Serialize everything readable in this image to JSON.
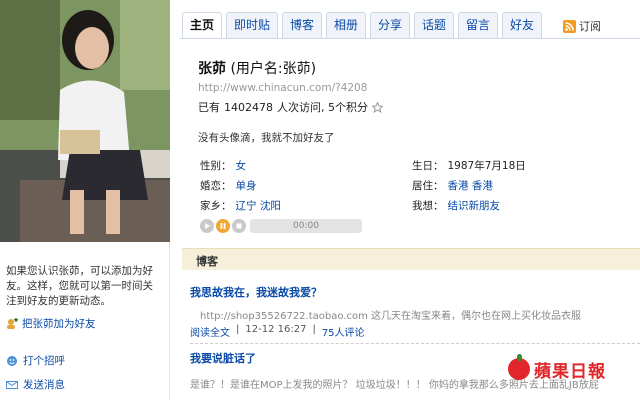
{
  "tabs": [
    "主页",
    "即时贴",
    "博客",
    "相册",
    "分享",
    "话题",
    "留言",
    "好友"
  ],
  "rss_label": "订阅",
  "profile": {
    "name": "张茆",
    "username": "(用户名:张茆)",
    "url": "http://www.chinacun.com/?4208",
    "visits_prefix": "已有",
    "visits_count": "1402478",
    "visits_suffix": "人次访问, 5个积分",
    "no_avatar_text": "没有头像滴，我就不加好友了",
    "gender_label": "性别：",
    "gender": "女",
    "marital_label": "婚恋：",
    "marital": "单身",
    "hometown_label": "家乡：",
    "hometown": "辽宁 沈阳",
    "birthday_label": "生日：",
    "birthday": "1987年7月18日",
    "residence_label": "居住：",
    "residence": "香港 香港",
    "wish_label": "我想：",
    "wish": "结识新朋友"
  },
  "player": {
    "time": "00:00"
  },
  "sidebar": {
    "intro": "如果您认识张茆，可以添加为好友。这样，您就可以第一时间关注到好友的更新动态。",
    "add_friend": "把张茆加为好友",
    "greet": "打个招呼",
    "message": "发送消息"
  },
  "blog": {
    "section_title": "博客",
    "post1_title": "我思故我在，我迷故我爱？",
    "post1_body": "http://shop35526722.taobao.com 这几天在淘宝来着，偶尔也在网上买化妆品衣服",
    "post1_read": "阅读全文",
    "post1_time": "12-12 16:27",
    "post1_comments": "75人评论",
    "post2_title": "我要说脏话了",
    "post2_body": "是谁？！是谁在MOP上发我的照片？ 垃圾垃圾！！！ 你妈的拿我那么多照片去上面乱JB放屁"
  },
  "watermark": "蘋果日報",
  "colors": {
    "link": "#0a4aa6",
    "blog_bar": "#f6f0da",
    "accent": "#f2a634"
  }
}
